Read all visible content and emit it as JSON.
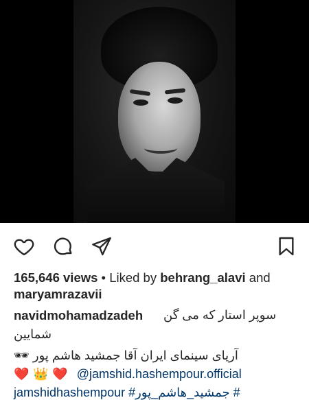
{
  "post": {
    "views_count": "165,646 views",
    "separator": " • ",
    "liked_by_prefix": "Liked by ",
    "liked_by_user": "behrang_alavi",
    "liked_by_and": " and",
    "liked_by_second": "maryamrazavii"
  },
  "caption": {
    "username": "navidmohamadzadeh",
    "line1": "سوپر استار که می گن",
    "line2": "شمایین",
    "line3": "آریای سینمای ایران آقا جمشید هاشم پور",
    "line3_emoji": "🕶",
    "line4_emojis": "❤️ 👑 ❤️",
    "line4_mention": "@jamshid.hashempour.official",
    "line5": "jamshidhashempour #جمشید_هاشم_پور #"
  },
  "icons": {
    "like": "heart-outline-icon",
    "comment": "comment-bubble-icon",
    "share": "paper-plane-icon",
    "save": "bookmark-icon"
  }
}
